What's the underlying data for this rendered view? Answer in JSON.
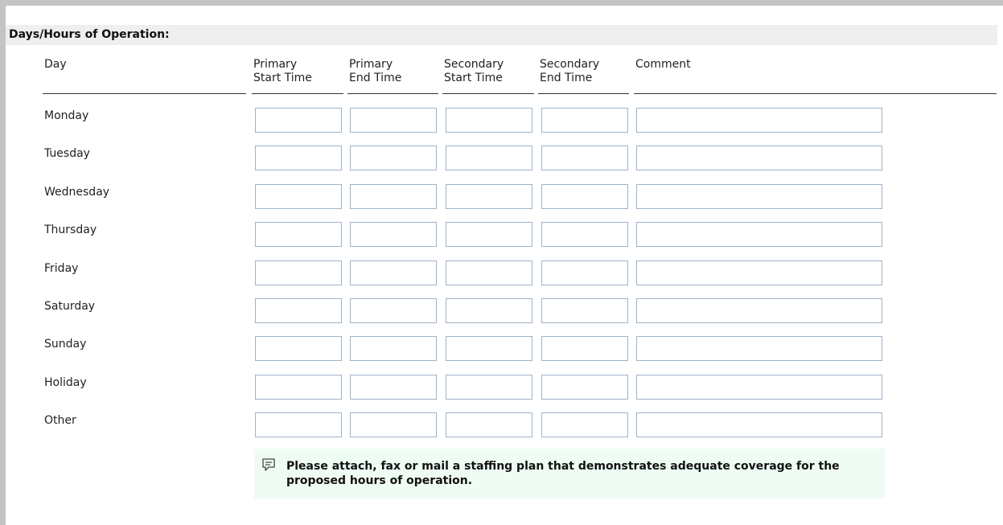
{
  "section": {
    "title": "Days/Hours of Operation:"
  },
  "columns": {
    "day": "Day",
    "primary_start_l1": "Primary",
    "primary_start_l2": "Start Time",
    "primary_end_l1": "Primary",
    "primary_end_l2": "End Time",
    "secondary_start_l1": "Secondary",
    "secondary_start_l2": "Start Time",
    "secondary_end_l1": "Secondary",
    "secondary_end_l2": "End Time",
    "comment": "Comment"
  },
  "rows": [
    {
      "day": "Monday",
      "primary_start": "",
      "primary_end": "",
      "secondary_start": "",
      "secondary_end": "",
      "comment": ""
    },
    {
      "day": "Tuesday",
      "primary_start": "",
      "primary_end": "",
      "secondary_start": "",
      "secondary_end": "",
      "comment": ""
    },
    {
      "day": "Wednesday",
      "primary_start": "",
      "primary_end": "",
      "secondary_start": "",
      "secondary_end": "",
      "comment": ""
    },
    {
      "day": "Thursday",
      "primary_start": "",
      "primary_end": "",
      "secondary_start": "",
      "secondary_end": "",
      "comment": ""
    },
    {
      "day": "Friday",
      "primary_start": "",
      "primary_end": "",
      "secondary_start": "",
      "secondary_end": "",
      "comment": ""
    },
    {
      "day": "Saturday",
      "primary_start": "",
      "primary_end": "",
      "secondary_start": "",
      "secondary_end": "",
      "comment": ""
    },
    {
      "day": "Sunday",
      "primary_start": "",
      "primary_end": "",
      "secondary_start": "",
      "secondary_end": "",
      "comment": ""
    },
    {
      "day": "Holiday",
      "primary_start": "",
      "primary_end": "",
      "secondary_start": "",
      "secondary_end": "",
      "comment": ""
    },
    {
      "day": "Other",
      "primary_start": "",
      "primary_end": "",
      "secondary_start": "",
      "secondary_end": "",
      "comment": ""
    }
  ],
  "note": {
    "icon": "comment-icon",
    "text": "Please attach, fax or mail a staffing plan that demonstrates adequate coverage for the proposed hours of operation."
  },
  "colors": {
    "header_bg": "#efefef",
    "frame": "#c4c4c4",
    "input_border": "#9fb3c8",
    "note_bg": "#eefcf3"
  }
}
